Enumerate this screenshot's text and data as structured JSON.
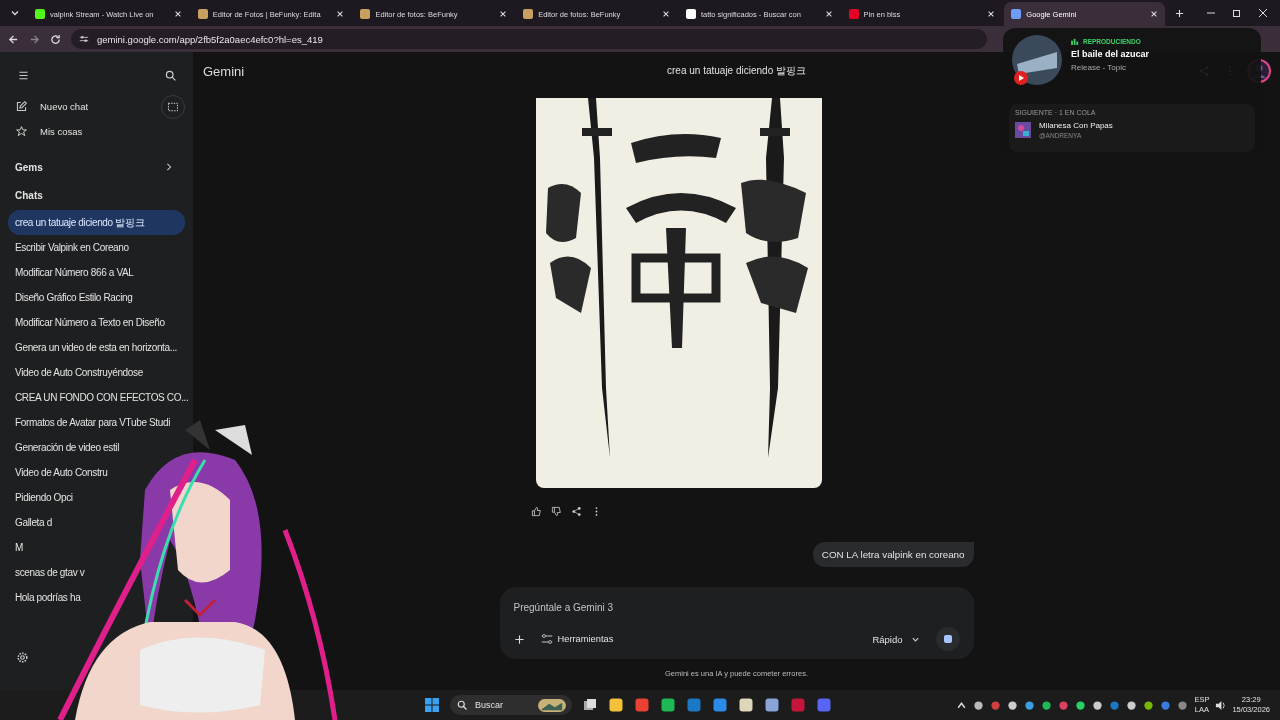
{
  "browser": {
    "tabs": [
      {
        "title": "valpink Stream - Watch Live on",
        "selected": false,
        "color": "#53fc18"
      },
      {
        "title": "Editor de Fotos | BeFunky: Edita",
        "selected": false,
        "color": "#c8a060"
      },
      {
        "title": "Editor de fotos: BeFunky",
        "selected": false,
        "color": "#c8a060"
      },
      {
        "title": "Editor de fotos: BeFunky",
        "selected": false,
        "color": "#c8a060"
      },
      {
        "title": "tatto significados - Buscar con",
        "selected": false,
        "color": "#ffffff"
      },
      {
        "title": "Pin en blss",
        "selected": false,
        "color": "#e60023"
      },
      {
        "title": "Google Gemini",
        "selected": true,
        "color": "#6f9cf7"
      }
    ],
    "url": "gemini.google.com/app/2fb5f2a0aec4efc0?hl=es_419"
  },
  "sidebar": {
    "items": [
      {
        "label": "Nuevo chat",
        "kind": "new"
      },
      {
        "label": "Mis cosas",
        "kind": "stuff"
      }
    ],
    "gems_label": "Gems",
    "chats_label": "Chats",
    "chats": [
      {
        "title": "crea un tatuaje diciendo 발핑크",
        "selected": true
      },
      {
        "title": "Escribir Valpink en Coreano",
        "selected": false
      },
      {
        "title": "Modificar Número 866 a VAL",
        "selected": false
      },
      {
        "title": "Diseño Gráfico Estilo Racing",
        "selected": false
      },
      {
        "title": "Modificar Número a Texto en Diseño",
        "selected": false
      },
      {
        "title": "Genera un video de esta en horizonta...",
        "selected": false
      },
      {
        "title": "Video de Auto Construyéndose",
        "selected": false
      },
      {
        "title": "CREA UN FONDO CON EFECTOS CO...",
        "selected": false
      },
      {
        "title": "Formatos de Avatar para VTube Studi",
        "selected": false
      },
      {
        "title": "Generación de video estil",
        "selected": false
      },
      {
        "title": "Video de Auto Constru",
        "selected": false
      },
      {
        "title": "Pidiendo Opci",
        "selected": false
      },
      {
        "title": "Galleta d",
        "selected": false
      },
      {
        "title": "M",
        "selected": false
      },
      {
        "title": "scenas de gtav v",
        "selected": false
      },
      {
        "title": "Hola podrías ha",
        "selected": false
      }
    ]
  },
  "header": {
    "brand": "Gemini",
    "chat_title": "crea un tatuaje diciendo 발핑크"
  },
  "conversation": {
    "user_message": "CON LA letra valpink en coreano"
  },
  "composer": {
    "placeholder": "Pregúntale a Gemini 3",
    "tools": "Herramientas",
    "mode": "Rápido",
    "disclaimer": "Gemini es una IA y puede cometer errores."
  },
  "media_popup": {
    "status": "REPRODUCIENDO",
    "song": "El baile del azucar",
    "artist": "Release - Topic",
    "queue_label": "SIGUIENTE · 1 EN COLA",
    "next_song": "Milanesa Con Papas",
    "next_artist": "@ANDRENYA"
  },
  "taskbar": {
    "search": "Buscar",
    "language": "ESP",
    "layout": "LAA",
    "time": "23:29",
    "date": "15/03/2026"
  }
}
